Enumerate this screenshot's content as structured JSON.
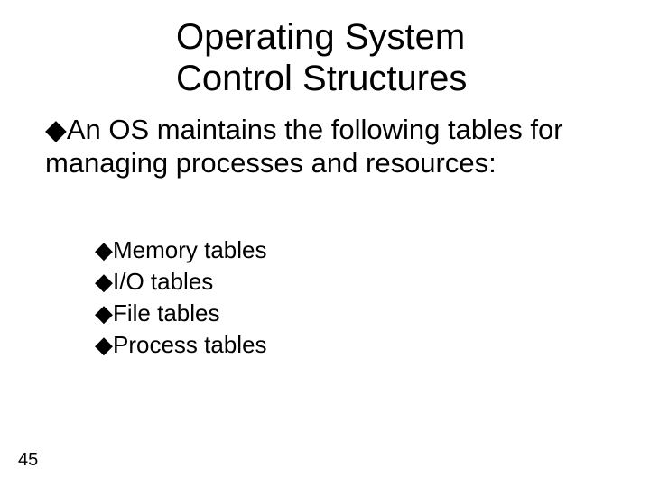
{
  "title_line1": "Operating System",
  "title_line2": "Control Structures",
  "intro": "An OS maintains the following tables for managing processes and resources:",
  "items": {
    "a": "Memory tables",
    "b": "I/O tables",
    "c": "File tables",
    "d": "Process tables"
  },
  "bullet": "◆",
  "page": "45"
}
